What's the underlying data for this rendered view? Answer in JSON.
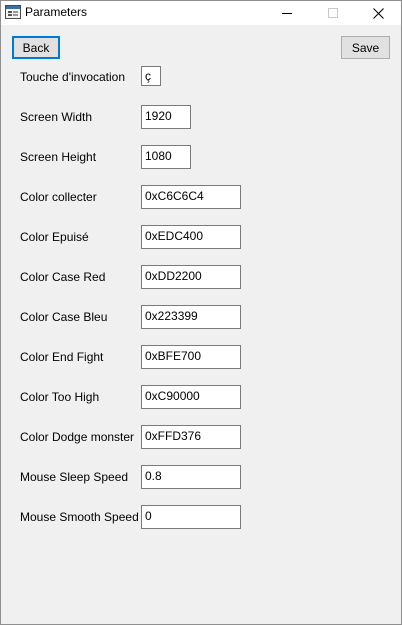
{
  "window": {
    "title": "Parameters"
  },
  "toolbar": {
    "back_label": "Back",
    "save_label": "Save"
  },
  "fields": [
    {
      "label": "Touche d'invocation",
      "value": "ç"
    },
    {
      "label": "Screen Width",
      "value": "1920"
    },
    {
      "label": "Screen Height",
      "value": "1080"
    },
    {
      "label": "Color collecter",
      "value": "0xC6C6C4"
    },
    {
      "label": "Color Epuisé",
      "value": "0xEDC400"
    },
    {
      "label": "Color Case Red",
      "value": "0xDD2200"
    },
    {
      "label": "Color Case Bleu",
      "value": "0x223399"
    },
    {
      "label": "Color End Fight",
      "value": "0xBFE700"
    },
    {
      "label": "Color Too High",
      "value": "0xC90000"
    },
    {
      "label": "Color Dodge monster",
      "value": "0xFFD376"
    },
    {
      "label": "Mouse Sleep Speed",
      "value": "0.8"
    },
    {
      "label": "Mouse Smooth Speed",
      "value": "0"
    }
  ],
  "colors": {
    "focus_accent": "#0078d7",
    "dialog_background": "#f0f0f0",
    "button_face": "#e1e1e1"
  }
}
